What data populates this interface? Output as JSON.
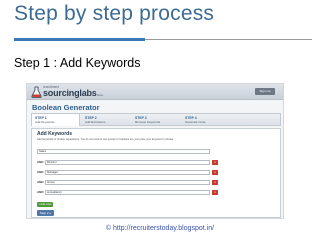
{
  "slide": {
    "title": "Step by step process",
    "step_heading": "Step 1 : Add Keywords",
    "credit": "© http://recruiterstoday.blogspot.in/"
  },
  "app": {
    "logo_small": "recruitment",
    "logo_big": "sourcinglabs",
    "logo_beta": "beta",
    "signin_label": "Sign me",
    "title": "Boolean Generator",
    "tabs": [
      {
        "step": "STEP 1",
        "name": "Add Keywords",
        "active": true
      },
      {
        "step": "STEP 2",
        "name": "Add Exclusions",
        "active": false
      },
      {
        "step": "STEP 3",
        "name": "Remove Keywords",
        "active": false
      },
      {
        "step": "STEP 4",
        "name": "Generate Code",
        "active": false
      }
    ],
    "panel": {
      "heading": "Add Keywords",
      "instructions": "Add keywords or phrase separations. You do not need to use quotes or brackets etc. just enter your keyword or phrase.",
      "first_keyword": "Sales",
      "rows": [
        {
          "op": "AND",
          "value": "Director",
          "remove_label": "x"
        },
        {
          "op": "AND",
          "value": "Manager",
          "remove_label": "x"
        },
        {
          "op": "AND",
          "value": "Group",
          "remove_label": "x"
        },
        {
          "op": "AND",
          "value": "consultancy",
          "remove_label": "x"
        }
      ],
      "add_label": "+ Add more",
      "next_label": "Step 2 »"
    }
  },
  "colors": {
    "title": "#3d6b94",
    "accent_rule": "#3b78b8",
    "remove": "#c8392f",
    "add": "#4e9a3b",
    "next": "#4f77a8",
    "credit": "#3a52a8"
  }
}
